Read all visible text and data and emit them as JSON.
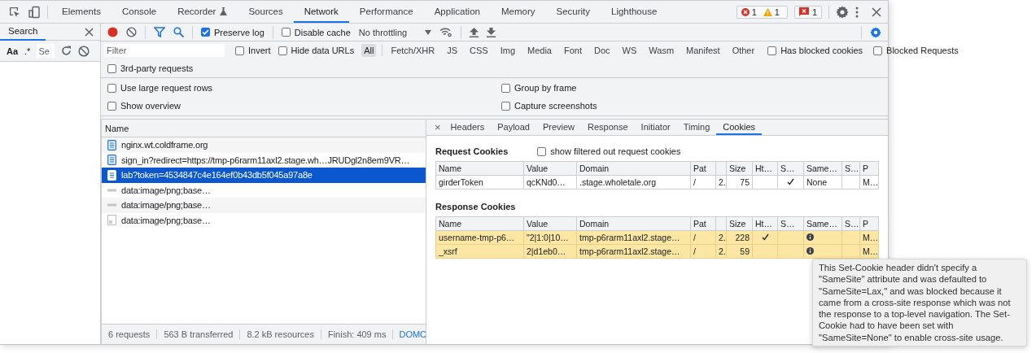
{
  "panel_tabs": [
    {
      "label": "Elements",
      "selected": false,
      "flask_icon": false
    },
    {
      "label": "Console",
      "selected": false,
      "flask_icon": false
    },
    {
      "label": "Recorder",
      "selected": false,
      "flask_icon": true
    },
    {
      "label": "Sources",
      "selected": false,
      "flask_icon": false
    },
    {
      "label": "Network",
      "selected": true,
      "flask_icon": false
    },
    {
      "label": "Performance",
      "selected": false,
      "flask_icon": false
    },
    {
      "label": "Application",
      "selected": false,
      "flask_icon": false
    },
    {
      "label": "Memory",
      "selected": false,
      "flask_icon": false
    },
    {
      "label": "Security",
      "selected": false,
      "flask_icon": false
    },
    {
      "label": "Lighthouse",
      "selected": false,
      "flask_icon": false
    }
  ],
  "issue_counters": [
    {
      "kind": "error",
      "count": "1"
    },
    {
      "kind": "warning",
      "count": "1"
    }
  ],
  "issues_badge": {
    "count": "1"
  },
  "search_panel": {
    "title": "Search",
    "match_case": "Aa",
    "regex": ".*",
    "placeholder": "Se"
  },
  "network_toolbar": {
    "recording": true,
    "preserve_log": {
      "label": "Preserve log",
      "checked": true
    },
    "disable_cache": {
      "label": "Disable cache",
      "checked": false
    },
    "throttling": "No throttling"
  },
  "filter_bar": {
    "placeholder": "Filter",
    "options": [
      {
        "label": "Invert",
        "checked": false
      },
      {
        "label": "Hide data URLs",
        "checked": false
      }
    ],
    "types": [
      {
        "label": "All",
        "selected": true
      },
      {
        "label": "Fetch/XHR",
        "selected": false
      },
      {
        "label": "JS",
        "selected": false
      },
      {
        "label": "CSS",
        "selected": false
      },
      {
        "label": "Img",
        "selected": false
      },
      {
        "label": "Media",
        "selected": false
      },
      {
        "label": "Font",
        "selected": false
      },
      {
        "label": "Doc",
        "selected": false
      },
      {
        "label": "WS",
        "selected": false
      },
      {
        "label": "Wasm",
        "selected": false
      },
      {
        "label": "Manifest",
        "selected": false
      },
      {
        "label": "Other",
        "selected": false
      }
    ],
    "trailing_options": [
      {
        "label": "Has blocked cookies",
        "checked": false
      },
      {
        "label": "Blocked Requests",
        "checked": false
      }
    ],
    "third_party": {
      "label": "3rd-party requests",
      "checked": false
    }
  },
  "settings": [
    {
      "label": "Use large request rows",
      "checked": false
    },
    {
      "label": "Group by frame",
      "checked": false
    },
    {
      "label": "Show overview",
      "checked": false
    },
    {
      "label": "Capture screenshots",
      "checked": false
    }
  ],
  "request_list": {
    "column": "Name",
    "rows": [
      {
        "name": "nginx.wt.coldframe.org",
        "kind": "document",
        "selected": false
      },
      {
        "name": "sign_in?redirect=https://tmp-p6rarm11axl2.stage.wh…JRUDgl2n8em9VR…",
        "kind": "document",
        "selected": false
      },
      {
        "name": "lab?token=4534847c4e164ef0b43db5f045a97a8e",
        "kind": "document",
        "selected": true
      },
      {
        "name": "data:image/png;base…",
        "kind": "dash",
        "selected": false
      },
      {
        "name": "data:image/png;base…",
        "kind": "dash",
        "selected": false
      },
      {
        "name": "data:image/png;base…",
        "kind": "image",
        "selected": false
      }
    ]
  },
  "status_bar": {
    "items": [
      "6 requests",
      "563 B transferred",
      "8.2 kB resources",
      "Finish: 409 ms"
    ],
    "link": "DOMC"
  },
  "detail_tabs": {
    "close": "×",
    "tabs": [
      {
        "label": "Headers",
        "selected": false
      },
      {
        "label": "Payload",
        "selected": false
      },
      {
        "label": "Preview",
        "selected": false
      },
      {
        "label": "Response",
        "selected": false
      },
      {
        "label": "Initiator",
        "selected": false
      },
      {
        "label": "Timing",
        "selected": false
      },
      {
        "label": "Cookies",
        "selected": true
      }
    ]
  },
  "request_cookies": {
    "title": "Request Cookies",
    "show_filtered": {
      "label": "show filtered out request cookies",
      "checked": false
    },
    "columns": [
      "Name",
      "Value",
      "Domain",
      "Pat",
      "",
      "Size",
      "Ht…",
      "S…",
      "Same…",
      "S…",
      "P"
    ],
    "rows": [
      {
        "name": "girderToken",
        "value": "qcKNd0…",
        "domain": ".stage.wholetale.org",
        "path": "/",
        "col5": "2.",
        "size": "75",
        "http_only": false,
        "secure": true,
        "same_site": "None",
        "samesite_warning": false,
        "priority": "M…",
        "blocked": false
      }
    ]
  },
  "response_cookies": {
    "title": "Response Cookies",
    "columns": [
      "Name",
      "Value",
      "Domain",
      "Pat",
      "",
      "Size",
      "Ht…",
      "S…",
      "Same…",
      "S…",
      "P"
    ],
    "rows": [
      {
        "name": "username-tmp-p6…",
        "value": "\"2|1:0|10…",
        "domain": "tmp-p6rarm11axl2.stage…",
        "path": "/",
        "col5": "2.",
        "size": "228",
        "http_only": true,
        "secure": false,
        "samesite_warning": true,
        "priority": "M…",
        "blocked": true
      },
      {
        "name": "_xsrf",
        "value": "2|d1eb0…",
        "domain": "tmp-p6rarm11axl2.stage…",
        "path": "/",
        "col5": "2.",
        "size": "59",
        "http_only": false,
        "secure": false,
        "samesite_warning": true,
        "priority": "M…",
        "blocked": true
      }
    ]
  },
  "tooltip": {
    "text": "This Set-Cookie header didn't specify a \"SameSite\" attribute and was defaulted to \"SameSite=Lax,\" and was blocked because it came from a cross-site response which was not the response to a top-level navigation. The Set-Cookie had to have been set with \"SameSite=None\" to enable cross-site usage."
  }
}
